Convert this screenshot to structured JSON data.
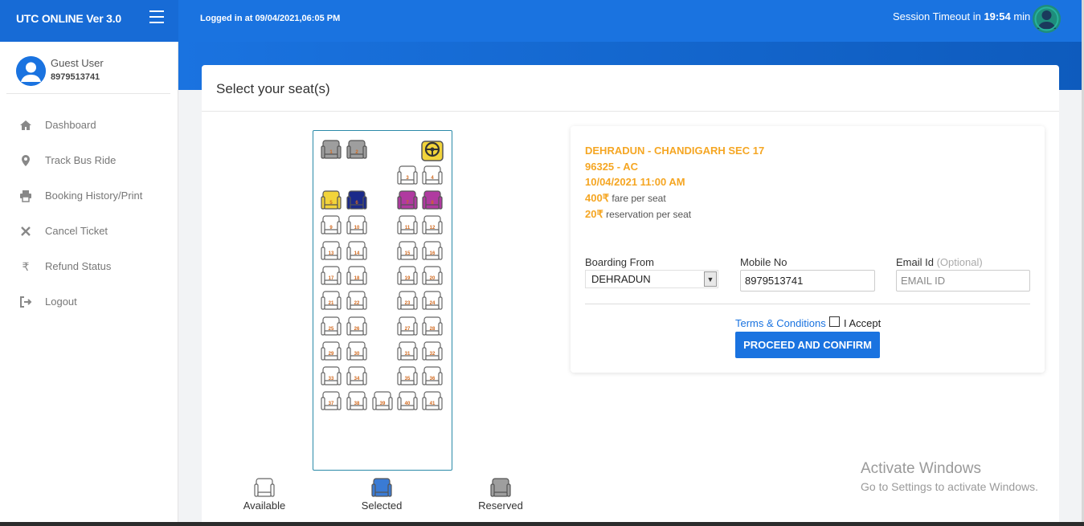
{
  "header": {
    "app_title": "UTC ONLINE Ver 3.0",
    "login_info": "Logged in at 09/04/2021,06:05 PM",
    "session_prefix": "Session Timeout in ",
    "session_time": "19:54",
    "session_suffix": " min"
  },
  "user": {
    "name": "Guest User",
    "phone": "8979513741"
  },
  "sidebar": {
    "items": [
      {
        "label": "Dashboard",
        "icon": "home-icon"
      },
      {
        "label": "Track Bus Ride",
        "icon": "map-pin-icon"
      },
      {
        "label": "Booking History/Print",
        "icon": "printer-icon"
      },
      {
        "label": "Cancel Ticket",
        "icon": "close-icon"
      },
      {
        "label": "Refund Status",
        "icon": "rupee-icon"
      },
      {
        "label": "Logout",
        "icon": "logout-icon"
      }
    ]
  },
  "main": {
    "title": "Select your seat(s)"
  },
  "seat_map": {
    "colors": {
      "available": "#ffffff",
      "reserved": "#9e9e9e",
      "selected": "#3a7bd5",
      "ladies": "#f2d43a",
      "booked_purple": "#b03aa0",
      "booked_navy": "#1b2a8a"
    },
    "seats": [
      {
        "n": "1",
        "status": "reserved"
      },
      {
        "n": "2",
        "status": "reserved"
      },
      {
        "n": "3",
        "status": "available"
      },
      {
        "n": "4",
        "status": "available"
      },
      {
        "n": "5",
        "status": "ladies"
      },
      {
        "n": "6",
        "status": "booked_navy"
      },
      {
        "n": "7",
        "status": "booked_purple"
      },
      {
        "n": "8",
        "status": "booked_purple"
      },
      {
        "n": "9",
        "status": "available"
      },
      {
        "n": "10",
        "status": "available"
      },
      {
        "n": "11",
        "status": "available"
      },
      {
        "n": "12",
        "status": "available"
      },
      {
        "n": "13",
        "status": "available"
      },
      {
        "n": "14",
        "status": "available"
      },
      {
        "n": "15",
        "status": "available"
      },
      {
        "n": "16",
        "status": "available"
      },
      {
        "n": "17",
        "status": "available"
      },
      {
        "n": "18",
        "status": "available"
      },
      {
        "n": "19",
        "status": "available"
      },
      {
        "n": "20",
        "status": "available"
      },
      {
        "n": "21",
        "status": "available"
      },
      {
        "n": "22",
        "status": "available"
      },
      {
        "n": "23",
        "status": "available"
      },
      {
        "n": "24",
        "status": "available"
      },
      {
        "n": "25",
        "status": "available"
      },
      {
        "n": "26",
        "status": "available"
      },
      {
        "n": "27",
        "status": "available"
      },
      {
        "n": "28",
        "status": "available"
      },
      {
        "n": "29",
        "status": "available"
      },
      {
        "n": "30",
        "status": "available"
      },
      {
        "n": "31",
        "status": "available"
      },
      {
        "n": "32",
        "status": "available"
      },
      {
        "n": "33",
        "status": "available"
      },
      {
        "n": "34",
        "status": "available"
      },
      {
        "n": "35",
        "status": "available"
      },
      {
        "n": "36",
        "status": "available"
      },
      {
        "n": "37",
        "status": "available"
      },
      {
        "n": "38",
        "status": "available"
      },
      {
        "n": "39",
        "status": "available"
      },
      {
        "n": "40",
        "status": "available"
      },
      {
        "n": "41",
        "status": "available"
      }
    ],
    "legend": [
      {
        "label": "Available",
        "status": "available"
      },
      {
        "label": "Selected",
        "status": "selected"
      },
      {
        "label": "Reserved",
        "status": "reserved"
      }
    ]
  },
  "trip": {
    "route": "DEHRADUN - CHANDIGARH SEC 17",
    "service": "96325 - AC",
    "datetime": "10/04/2021 11:00 AM",
    "fare": "400",
    "fare_text": " fare per seat",
    "reservation": "20",
    "reservation_text": " reservation per seat",
    "currency": "₹"
  },
  "form": {
    "boarding_label": "Boarding From",
    "boarding_value": "DEHRADUN",
    "mobile_label": "Mobile No",
    "mobile_value": "8979513741",
    "email_label": "Email Id",
    "email_optional": "(Optional)",
    "email_placeholder": "EMAIL ID",
    "terms_label": "Terms & Conditions",
    "accept_label": "I Accept",
    "proceed_label": "PROCEED AND CONFIRM"
  },
  "watermark": {
    "line1": "Activate Windows",
    "line2": "Go to Settings to activate Windows."
  }
}
